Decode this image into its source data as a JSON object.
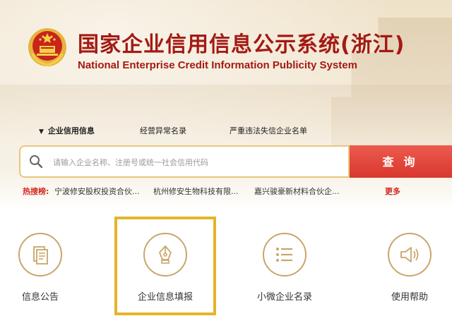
{
  "header": {
    "title_cn": "国家企业信用信息公示系统(浙江)",
    "title_en": "National Enterprise Credit Information Publicity System"
  },
  "tabs": [
    {
      "label": "企业信用信息",
      "active": true
    },
    {
      "label": "经营异常名录",
      "active": false
    },
    {
      "label": "严重违法失信企业名单",
      "active": false
    }
  ],
  "search": {
    "placeholder": "请输入企业名称、注册号或统一社会信用代码",
    "button_label": "查询"
  },
  "hot": {
    "label": "热搜榜:",
    "items": [
      "宁波修安股权投资合伙...",
      "杭州修安生物科技有限...",
      "嘉兴骏豪新材料合伙企..."
    ],
    "more": "更多"
  },
  "features": [
    {
      "label": "信息公告",
      "icon": "document-icon"
    },
    {
      "label": "企业信息填报",
      "icon": "pen-nib-icon"
    },
    {
      "label": "小微企业名录",
      "icon": "list-icon"
    },
    {
      "label": "使用帮助",
      "icon": "speaker-icon"
    }
  ],
  "colors": {
    "brand_red": "#a31a14",
    "button_red": "#e04b40",
    "gold": "#c9a66a",
    "highlight": "#e3b52a"
  }
}
